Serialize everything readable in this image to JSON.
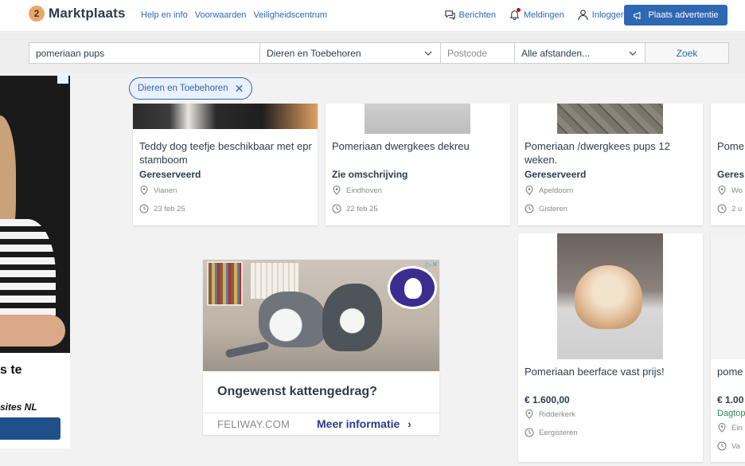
{
  "header": {
    "logo_mark": "2",
    "logo_text": "Marktplaats",
    "links": [
      "Help en info",
      "Voorwaarden",
      "Veiligheidscentrum"
    ],
    "nav": {
      "messages": "Berichten",
      "notifications": "Meldingen",
      "login": "Inloggen"
    },
    "place_ad": "Plaats advertentie"
  },
  "search": {
    "query": "pomeriaan pups",
    "category": "Dieren en Toebehoren",
    "postcode_placeholder": "Postcode",
    "distance": "Alle afstanden...",
    "button": "Zoek"
  },
  "filter_chip": {
    "label": "Dieren en Toebehoren",
    "remove": "✕"
  },
  "left_ad": {
    "line1": "s te",
    "line2": "sites NL"
  },
  "listings": [
    {
      "title": "Teddy dog teefje beschikbaar met epr stamboom",
      "price": "Gereserveerd",
      "location": "Vianen",
      "date": "23 feb 25"
    },
    {
      "title": "Pomeriaan dwergkees dekreu",
      "price": "Zie omschrijving",
      "location": "Eindhoven",
      "date": "22 feb 25"
    },
    {
      "title": "Pomeriaan /dwergkees pups 12 weken.",
      "price": "Gereserveerd",
      "location": "Apeldoorn",
      "date": "Gisteren"
    },
    {
      "title": "Pome",
      "price": "Geres",
      "location": "Wo",
      "date": "2 u"
    },
    {
      "title": "Pomeriaan beerface vast prijs!",
      "price": "€ 1.600,00",
      "location": "Ridderkerk",
      "date": "Eergisteren"
    },
    {
      "title": "pome",
      "price": "€ 1.00",
      "sub": "Dagtop",
      "location": "Ein",
      "date": "Va"
    }
  ],
  "feliway_ad": {
    "headline": "Ongewenst kattengedrag?",
    "domain": "FELIWAY.COM",
    "cta": "Meer informatie",
    "cta_arrow": "›"
  },
  "colors": {
    "brand_blue": "#2e67b2",
    "logo_orange": "#eda566",
    "text": "#2d3c4d",
    "muted": "#8a8a8a"
  }
}
